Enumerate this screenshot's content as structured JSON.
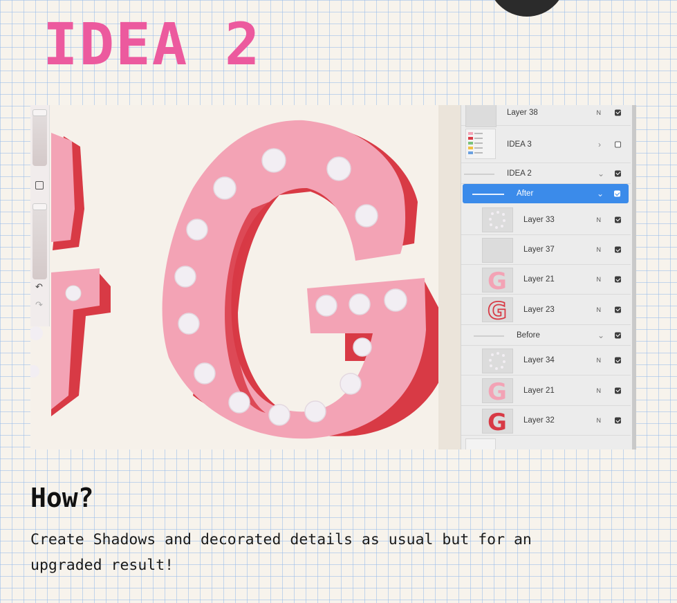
{
  "slide": {
    "title": "IDEA 2",
    "heading": "How?",
    "description": "Create Shadows and decorated details as usual but for an upgraded result!"
  },
  "colors": {
    "title_pink": "#ec5a9e",
    "letter_pink": "#f3a3b5",
    "shadow_red": "#d83a45",
    "selection_blue": "#3b8bea"
  },
  "layers_panel": {
    "rows": [
      {
        "label": "Layer 38",
        "mode": "N",
        "visible": true,
        "kind": "layer"
      },
      {
        "label": "IDEA 3",
        "chevron": "›",
        "visible": false,
        "kind": "group"
      },
      {
        "label": "IDEA 2",
        "chevron": "⌄",
        "visible": true,
        "kind": "group"
      },
      {
        "label": "After",
        "chevron": "⌄",
        "visible": true,
        "kind": "group",
        "selected": true
      },
      {
        "label": "Layer 33",
        "mode": "N",
        "visible": true,
        "kind": "layer",
        "thumb": "dots-icon"
      },
      {
        "label": "Layer 37",
        "mode": "N",
        "visible": true,
        "kind": "layer"
      },
      {
        "label": "Layer 21",
        "mode": "N",
        "visible": true,
        "kind": "layer",
        "thumb": "pink-g-icon"
      },
      {
        "label": "Layer 23",
        "mode": "N",
        "visible": true,
        "kind": "layer",
        "thumb": "red-g-outline-icon"
      },
      {
        "label": "Before",
        "chevron": "⌄",
        "visible": true,
        "kind": "group"
      },
      {
        "label": "Layer 34",
        "mode": "N",
        "visible": true,
        "kind": "layer",
        "thumb": "dots-icon"
      },
      {
        "label": "Layer 21",
        "mode": "N",
        "visible": true,
        "kind": "layer",
        "thumb": "pink-g-icon"
      },
      {
        "label": "Layer 32",
        "mode": "N",
        "visible": true,
        "kind": "layer",
        "thumb": "red-g-icon"
      }
    ]
  },
  "toolbar": {
    "undo_icon": "↶",
    "redo_icon": "↷"
  }
}
